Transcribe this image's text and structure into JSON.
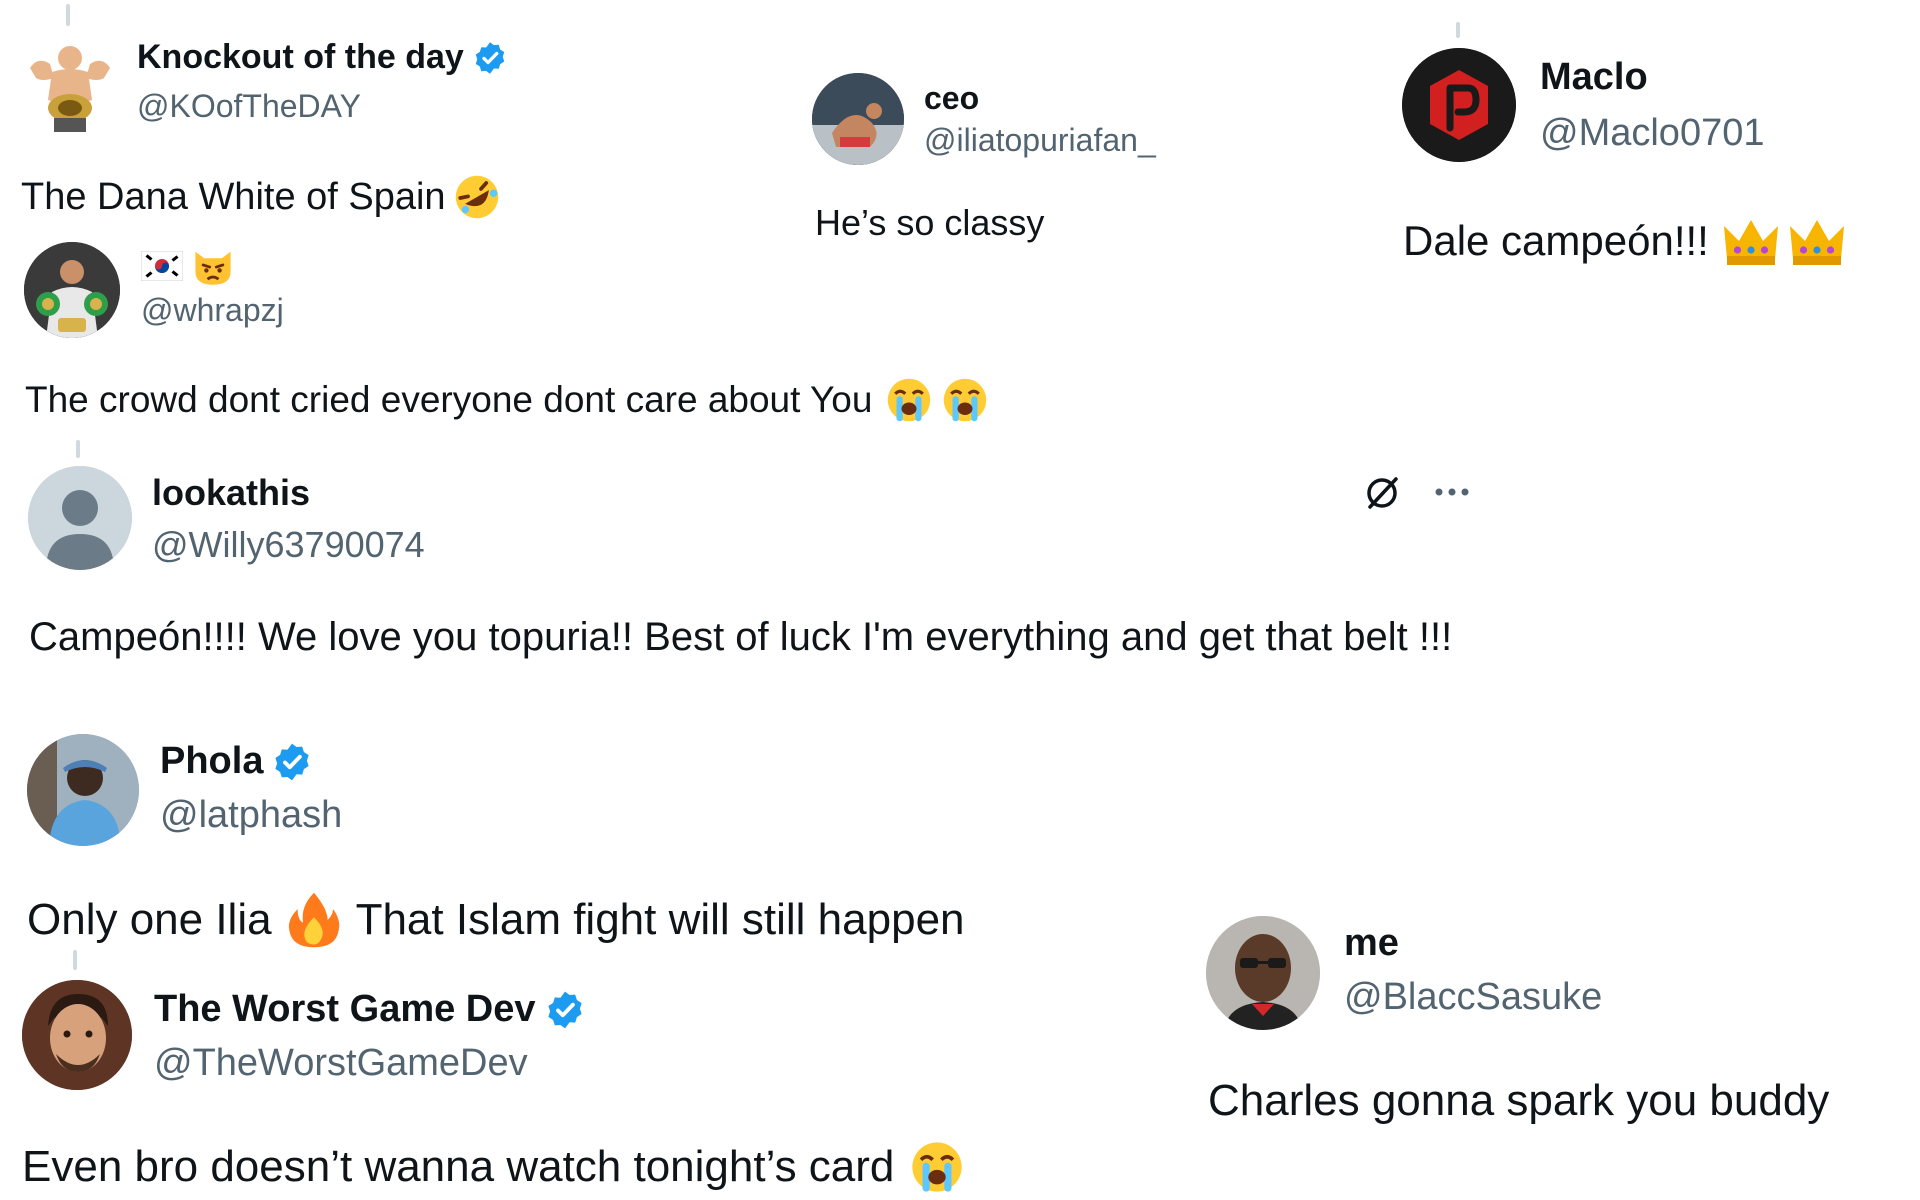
{
  "tweets": [
    {
      "name": "Knockout of the day",
      "handle": "@KOofTheDAY",
      "text": "The Dana White of Spain",
      "emojis": [
        "rolling-on-floor-laughing"
      ],
      "verified": true
    },
    {
      "name": "ceo",
      "handle": "@iliatopuriafan_",
      "text": "He’s so classy",
      "emojis": [],
      "verified": false
    },
    {
      "name": "Maclo",
      "handle": "@Maclo0701",
      "text": "Dale campeón!!!",
      "emojis": [
        "crown",
        "crown"
      ],
      "verified": false
    },
    {
      "name": "",
      "name_emojis": [
        "south-korea-flag",
        "pouting-cat"
      ],
      "handle": "@whrapzj",
      "text": "The crowd dont cried everyone dont care about You",
      "emojis": [
        "loudly-crying-face",
        "loudly-crying-face"
      ],
      "verified": false
    },
    {
      "name": "lookathis",
      "handle": "@Willy63790074",
      "text": "Campeón!!!! We love you topuria!! Best of luck I'm everything and get that belt !!!",
      "emojis": [],
      "verified": false,
      "actions": [
        "grok-icon",
        "more-icon"
      ]
    },
    {
      "name": "Phola",
      "handle": "@latphash",
      "text_before": "Only one Ilia",
      "text_after": "That Islam fight will still happen",
      "emojis": [
        "fire"
      ],
      "verified": true
    },
    {
      "name": "The Worst Game Dev",
      "handle": "@TheWorstGameDev",
      "text": "Even bro doesn’t wanna watch tonight’s card",
      "emojis": [
        "loudly-crying-face"
      ],
      "verified": true
    },
    {
      "name": "me",
      "handle": "@BlaccSasuke",
      "text": "Charles gonna spark you buddy",
      "emojis": [],
      "verified": false
    }
  ],
  "colors": {
    "verified_blue": "#1d9bf0",
    "handle_gray": "#536471",
    "text": "#0f1419",
    "connector": "#cfd9de"
  }
}
